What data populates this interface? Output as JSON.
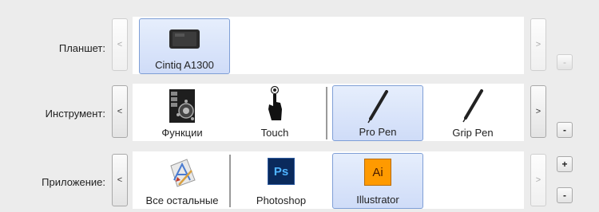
{
  "rows": [
    {
      "label": "Планшет:",
      "prev": "<",
      "next": ">",
      "tiles": [
        {
          "label": "Cintiq A1300",
          "icon": "tablet-icon",
          "selected": true
        }
      ],
      "minus": "-"
    },
    {
      "label": "Инструмент:",
      "prev": "<",
      "next": ">",
      "tiles": [
        {
          "label": "Функции",
          "icon": "functions-icon",
          "selected": false
        },
        {
          "label": "Touch",
          "icon": "touch-icon",
          "selected": false
        },
        {
          "label": "Pro Pen",
          "icon": "pen-icon",
          "selected": true
        },
        {
          "label": "Grip Pen",
          "icon": "pen-icon",
          "selected": false
        }
      ],
      "minus": "-"
    },
    {
      "label": "Приложение:",
      "prev": "<",
      "next": ">",
      "tiles": [
        {
          "label": "Все остальные",
          "icon": "all-apps-icon",
          "selected": false
        },
        {
          "label": "Photoshop",
          "icon": "photoshop-icon",
          "selected": false,
          "icon_text": "Ps"
        },
        {
          "label": "Illustrator",
          "icon": "illustrator-icon",
          "selected": true,
          "icon_text": "Ai"
        }
      ],
      "plus": "+",
      "minus": "-"
    }
  ],
  "colors": {
    "selection_fill": "#cfdcf8",
    "selection_border": "#7f9fd6",
    "photoshop": "#0a2a5c",
    "photoshop_text": "#4fb3ff",
    "illustrator": "#ff9a00",
    "illustrator_text": "#4a1a00"
  }
}
